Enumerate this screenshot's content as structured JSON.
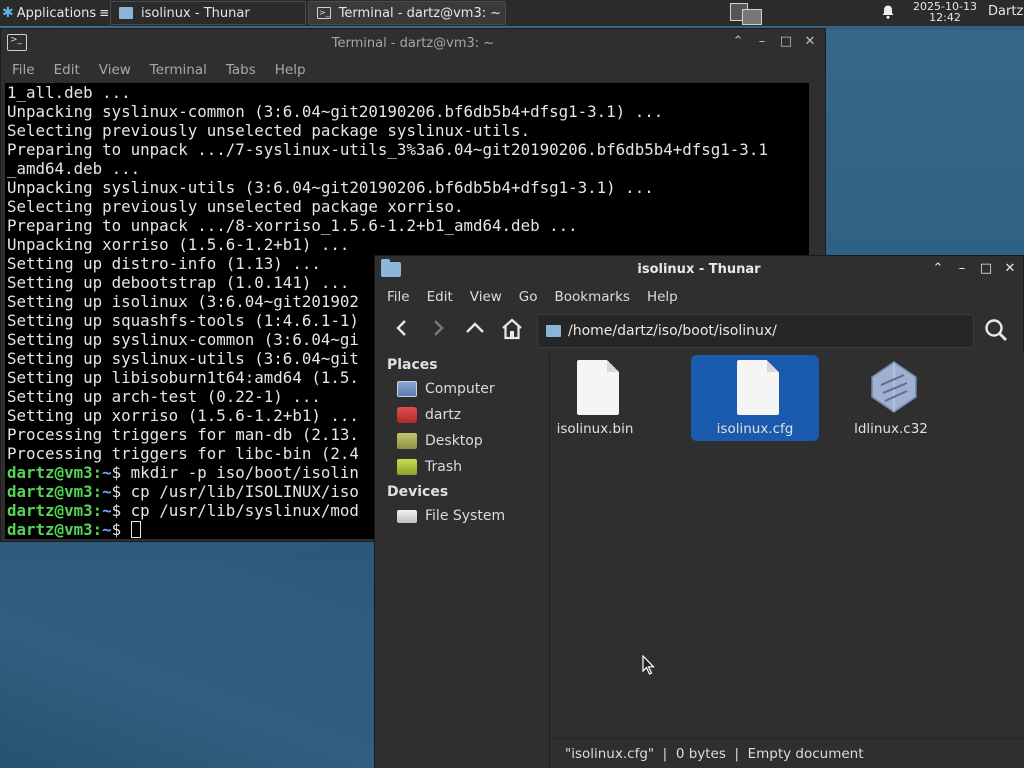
{
  "panel": {
    "apps_label": "Applications",
    "apps_suffix": "≡",
    "tasks": [
      {
        "label": "isolinux - Thunar"
      },
      {
        "label": "Terminal - dartz@vm3: ~"
      }
    ],
    "clock_date": "2025-10-13",
    "clock_time": "12:42",
    "user": "Dartz"
  },
  "terminal": {
    "title": "Terminal - dartz@vm3: ~",
    "menu": [
      "File",
      "Edit",
      "View",
      "Terminal",
      "Tabs",
      "Help"
    ],
    "lines": [
      "1_all.deb ...",
      "Unpacking syslinux-common (3:6.04~git20190206.bf6db5b4+dfsg1-3.1) ...",
      "Selecting previously unselected package syslinux-utils.",
      "Preparing to unpack .../7-syslinux-utils_3%3a6.04~git20190206.bf6db5b4+dfsg1-3.1",
      "_amd64.deb ...",
      "Unpacking syslinux-utils (3:6.04~git20190206.bf6db5b4+dfsg1-3.1) ...",
      "Selecting previously unselected package xorriso.",
      "Preparing to unpack .../8-xorriso_1.5.6-1.2+b1_amd64.deb ...",
      "Unpacking xorriso (1.5.6-1.2+b1) ...",
      "Setting up distro-info (1.13) ...",
      "Setting up debootstrap (1.0.141) ...",
      "Setting up isolinux (3:6.04~git201902",
      "Setting up squashfs-tools (1:4.6.1-1)",
      "Setting up syslinux-common (3:6.04~gi",
      "Setting up syslinux-utils (3:6.04~git",
      "Setting up libisoburn1t64:amd64 (1.5.",
      "Setting up arch-test (0.22-1) ...",
      "Setting up xorriso (1.5.6-1.2+b1) ...",
      "Processing triggers for man-db (2.13.",
      "Processing triggers for libc-bin (2.4"
    ],
    "prompt_user": "dartz@vm3",
    "prompt_sep": ":",
    "prompt_path": "~",
    "prompt_sign": "$",
    "commands": [
      " mkdir -p iso/boot/isolin",
      " cp /usr/lib/ISOLINUX/iso",
      " cp /usr/lib/syslinux/mod",
      " "
    ]
  },
  "thunar": {
    "title": "isolinux - Thunar",
    "menu": [
      "File",
      "Edit",
      "View",
      "Go",
      "Bookmarks",
      "Help"
    ],
    "location": "/home/dartz/iso/boot/isolinux/",
    "places_header": "Places",
    "places": [
      "Computer",
      "dartz",
      "Desktop",
      "Trash"
    ],
    "devices_header": "Devices",
    "devices": [
      "File System"
    ],
    "files": [
      {
        "name": "isolinux.bin",
        "selected": false
      },
      {
        "name": "isolinux.cfg",
        "selected": true
      },
      {
        "name": "ldlinux.c32",
        "selected": false
      }
    ],
    "status": "\"isolinux.cfg\"  |  0 bytes  |  Empty document"
  },
  "colors": {
    "selection": "#1a5aad",
    "prompt_green": "#55d455",
    "prompt_blue": "#6aa8ff"
  }
}
